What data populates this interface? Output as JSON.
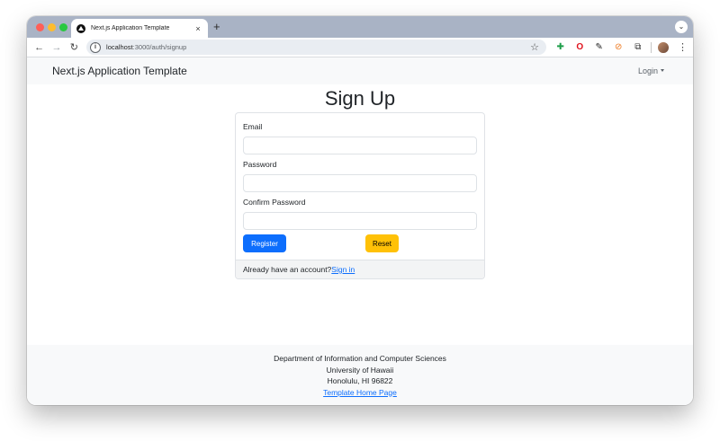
{
  "browser": {
    "tab_title": "Next.js Application Template",
    "tab_close": "×",
    "new_tab": "+",
    "url_host": "localhost",
    "url_path": ":3000/auth/signup"
  },
  "navbar": {
    "brand": "Next.js Application Template",
    "login_label": "Login"
  },
  "form": {
    "heading": "Sign Up",
    "email_label": "Email",
    "password_label": "Password",
    "confirm_password_label": "Confirm Password",
    "email_value": "",
    "password_value": "",
    "confirm_password_value": "",
    "register_label": "Register",
    "reset_label": "Reset",
    "footer_text": "Already have an account?",
    "signin_link": "Sign in"
  },
  "footer": {
    "line1": "Department of Information and Computer Sciences",
    "line2": "University of Hawaii",
    "line3": "Honolulu, HI 96822",
    "link": "Template Home Page"
  },
  "colors": {
    "primary": "#0d6efd",
    "warning": "#ffc107",
    "navbar_bg": "#f8f9fa"
  },
  "icons": [
    "back-icon",
    "forward-icon",
    "reload-icon",
    "site-info-icon",
    "bookmark-star-icon",
    "extension-icon",
    "opera-icon",
    "pen-icon",
    "orange-extension-icon",
    "puzzle-icon",
    "profile-avatar-icon",
    "menu-kebab-icon"
  ]
}
